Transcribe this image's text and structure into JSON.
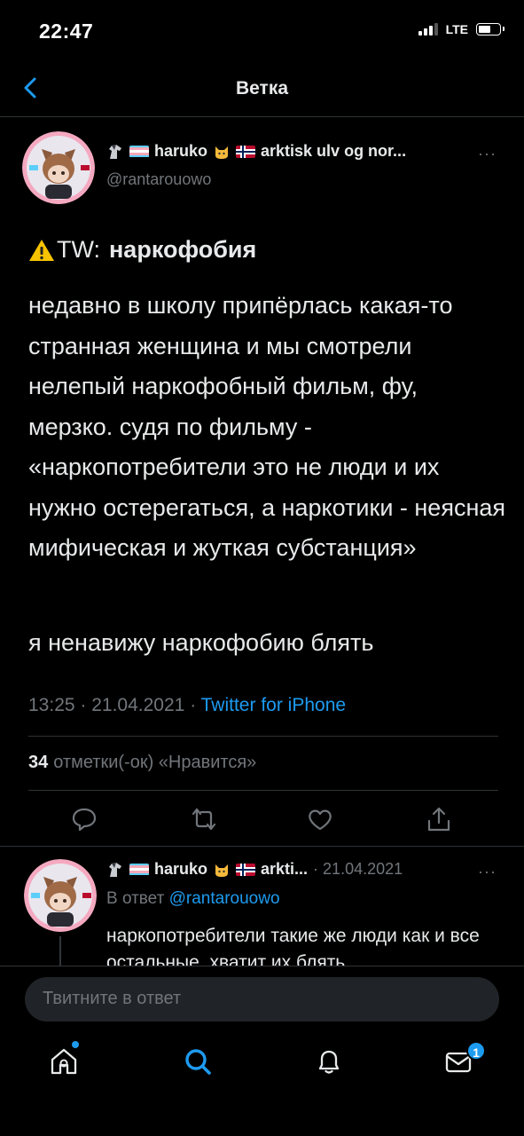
{
  "status_bar": {
    "time": "22:47",
    "network": "LTE"
  },
  "nav": {
    "title": "Ветка"
  },
  "tweet": {
    "author_name": "haruko",
    "author_name_rest": "arktisk ulv og nor...",
    "handle": "@rantarouowo",
    "tw_prefix": "TW:",
    "tw_topic": "наркофобия",
    "body": "недавно в школу припёрлась какая-то странная женщина и мы смотрели нелепый наркофобный фильм, фу, мерзко. судя по фильму - «наркопотребители это не люди и их нужно остерегаться, а наркотики - неясная мифическая и жуткая субстанция»",
    "body2": "я ненавижу наркофобию блять",
    "time": "13:25",
    "date": "21.04.2021",
    "source": "Twitter for iPhone",
    "likes_count": "34",
    "likes_label": "отметки(-ок) «Нравится»"
  },
  "reply": {
    "author_name": "haruko",
    "author_name_rest": "arkti...",
    "date": "· 21.04.2021",
    "reply_prefix": "В ответ",
    "reply_mention": "@rantarouowo",
    "text": "наркопотребители такие же люди как и все остальные, хватит их блять"
  },
  "compose": {
    "placeholder": "Твитните в ответ"
  },
  "tab_bar": {
    "messages_badge": "1"
  },
  "colors": {
    "accent": "#1d9bf0",
    "background": "#000000",
    "muted": "#71767b"
  }
}
